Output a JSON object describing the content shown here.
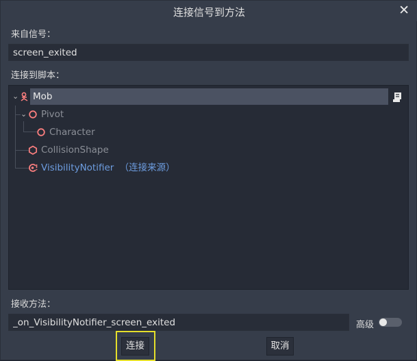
{
  "dialog": {
    "title": "连接信号到方法",
    "close_icon": "close-icon"
  },
  "signal": {
    "label": "来自信号：",
    "value": "screen_exited"
  },
  "script": {
    "label": "连接到脚本：",
    "tree": [
      {
        "name": "Mob",
        "icon": "rigidbody-icon",
        "selected": true,
        "has_script": true
      },
      {
        "name": "Pivot",
        "icon": "node2d-icon"
      },
      {
        "name": "Character",
        "icon": "node2d-icon"
      },
      {
        "name": "CollisionShape",
        "icon": "collision-shape-icon"
      },
      {
        "name": "VisibilityNotifier",
        "icon": "visibility-notifier-icon",
        "suffix": "（连接来源）",
        "source": true
      }
    ]
  },
  "method": {
    "label": "接收方法：",
    "value": "_on_VisibilityNotifier_screen_exited",
    "advanced_label": "高级",
    "advanced_on": false
  },
  "buttons": {
    "connect": "连接",
    "cancel": "取消"
  },
  "colors": {
    "node_disabled": "#8b8f97",
    "node_normal": "#e0e0e0",
    "source_link": "#6d9de0",
    "icon_red": "#fc7f7f"
  }
}
